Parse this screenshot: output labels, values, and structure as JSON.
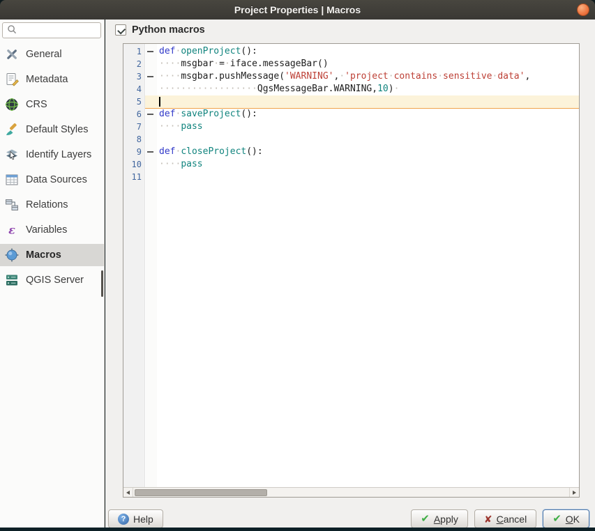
{
  "window": {
    "title": "Project Properties | Macros"
  },
  "sidebar": {
    "search": {
      "placeholder": ""
    },
    "items": [
      {
        "label": "General",
        "icon": "general-icon",
        "selected": false
      },
      {
        "label": "Metadata",
        "icon": "metadata-icon",
        "selected": false
      },
      {
        "label": "CRS",
        "icon": "crs-icon",
        "selected": false
      },
      {
        "label": "Default Styles",
        "icon": "default-styles-icon",
        "selected": false
      },
      {
        "label": "Identify Layers",
        "icon": "identify-layers-icon",
        "selected": false
      },
      {
        "label": "Data Sources",
        "icon": "data-sources-icon",
        "selected": false
      },
      {
        "label": "Relations",
        "icon": "relations-icon",
        "selected": false
      },
      {
        "label": "Variables",
        "icon": "variables-icon",
        "selected": false
      },
      {
        "label": "Macros",
        "icon": "macros-icon",
        "selected": true
      },
      {
        "label": "QGIS Server",
        "icon": "qgis-server-icon",
        "selected": false
      }
    ]
  },
  "content": {
    "python_macros": {
      "label": "Python macros",
      "checked": true
    }
  },
  "editor": {
    "language": "python",
    "current_line": 5,
    "code_text": "def openProject():\n    msgbar = iface.messageBar()\n    msgbar.pushMessage('WARNING', 'project contains sensitive data',\n                  QgsMessageBar.WARNING,10) \n\ndef saveProject():\n    pass\n\ndef closeProject():\n    pass\n",
    "lines": [
      {
        "num": 1,
        "fold": true,
        "current": false,
        "segments": [
          {
            "c": "kw",
            "t": "def"
          },
          {
            "c": "ws",
            "t": "·"
          },
          {
            "c": "name",
            "t": "openProject"
          },
          {
            "c": "plain",
            "t": "():"
          }
        ]
      },
      {
        "num": 2,
        "fold": false,
        "current": false,
        "segments": [
          {
            "c": "ws",
            "t": "····"
          },
          {
            "c": "plain",
            "t": "msgbar"
          },
          {
            "c": "ws",
            "t": "·"
          },
          {
            "c": "plain",
            "t": "="
          },
          {
            "c": "ws",
            "t": "·"
          },
          {
            "c": "plain",
            "t": "iface.messageBar()"
          }
        ]
      },
      {
        "num": 3,
        "fold": true,
        "current": false,
        "segments": [
          {
            "c": "ws",
            "t": "····"
          },
          {
            "c": "plain",
            "t": "msgbar.pushMessage("
          },
          {
            "c": "str",
            "t": "'WARNING'"
          },
          {
            "c": "plain",
            "t": ","
          },
          {
            "c": "ws",
            "t": "·"
          },
          {
            "c": "str",
            "t": "'project"
          },
          {
            "c": "ws",
            "t": "·"
          },
          {
            "c": "str",
            "t": "contains"
          },
          {
            "c": "ws",
            "t": "·"
          },
          {
            "c": "str",
            "t": "sensitive"
          },
          {
            "c": "ws",
            "t": "·"
          },
          {
            "c": "str",
            "t": "data'"
          },
          {
            "c": "plain",
            "t": ","
          }
        ]
      },
      {
        "num": 4,
        "fold": false,
        "current": false,
        "segments": [
          {
            "c": "ws",
            "t": "··················"
          },
          {
            "c": "plain",
            "t": "QgsMessageBar.WARNING,"
          },
          {
            "c": "num",
            "t": "10"
          },
          {
            "c": "plain",
            "t": ")"
          },
          {
            "c": "ws",
            "t": "·"
          }
        ]
      },
      {
        "num": 5,
        "fold": false,
        "current": true,
        "segments": []
      },
      {
        "num": 6,
        "fold": true,
        "current": false,
        "segments": [
          {
            "c": "kw",
            "t": "def"
          },
          {
            "c": "ws",
            "t": "·"
          },
          {
            "c": "name",
            "t": "saveProject"
          },
          {
            "c": "plain",
            "t": "():"
          }
        ]
      },
      {
        "num": 7,
        "fold": false,
        "current": false,
        "segments": [
          {
            "c": "ws",
            "t": "····"
          },
          {
            "c": "name",
            "t": "pass"
          }
        ]
      },
      {
        "num": 8,
        "fold": false,
        "current": false,
        "segments": []
      },
      {
        "num": 9,
        "fold": true,
        "current": false,
        "segments": [
          {
            "c": "kw",
            "t": "def"
          },
          {
            "c": "ws",
            "t": "·"
          },
          {
            "c": "name",
            "t": "closeProject"
          },
          {
            "c": "plain",
            "t": "():"
          }
        ]
      },
      {
        "num": 10,
        "fold": false,
        "current": false,
        "segments": [
          {
            "c": "ws",
            "t": "····"
          },
          {
            "c": "name",
            "t": "pass"
          }
        ]
      },
      {
        "num": 11,
        "fold": false,
        "current": false,
        "segments": []
      }
    ]
  },
  "buttons": {
    "help": "Help",
    "apply": "Apply",
    "cancel": "Cancel",
    "ok": "OK"
  },
  "colors": {
    "titlebar": "#3c3a36",
    "close_button": "#ef7a44",
    "sidebar_selection": "#d8d7d4",
    "keyword": "#3139c8",
    "definition_name": "#11847e",
    "string": "#bd4036",
    "number": "#11847e",
    "line_number": "#41669e",
    "current_line_bg": "#fcf3da",
    "current_line_underline": "#f0a24c"
  }
}
